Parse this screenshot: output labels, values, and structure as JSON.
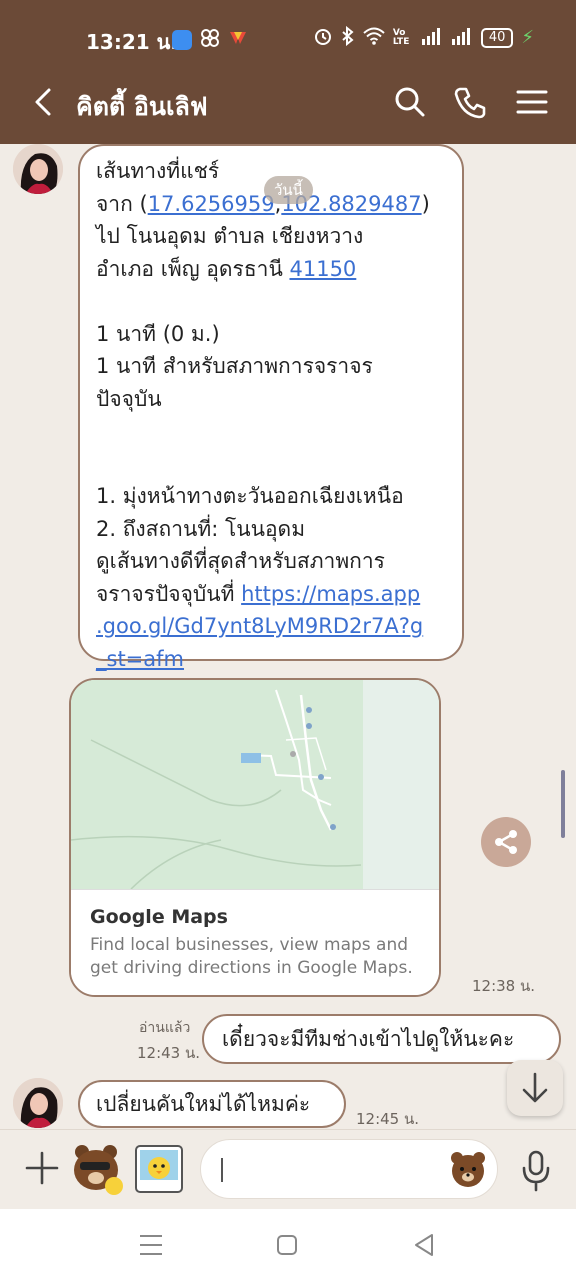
{
  "status_bar": {
    "time": "13:21 น.",
    "battery": "40",
    "network": "Vo LTE",
    "app_icons": [
      "blue-app-icon",
      "pinwheel-icon",
      "red-yellow-app-icon"
    ]
  },
  "header": {
    "title": "คิตตี้ อินเลิฟ",
    "icons": [
      "back-arrow-icon",
      "search-icon",
      "phone-icon",
      "menu-icon"
    ]
  },
  "chat": {
    "date_pill": "วันนี้",
    "message1": {
      "line1": "เส้นทางที่แชร์",
      "from_prefix": "จาก (",
      "coord1": "17.6256959",
      "comma": ",",
      "coord2": "102.8829487",
      "from_suffix": ")",
      "line3": "ไป โนนอุดม ตำบล เชียงหวาง",
      "line4_prefix": "อำเภอ เพ็ญ อุดรธานี ",
      "postcode": "41150",
      "duration": "1 นาที (0 ม.)",
      "traffic1": "1 นาที สำหรับสภาพการจราจร",
      "traffic2": "ปัจจุบัน",
      "step1": "1. มุ่งหน้าทางตะวันออกเฉียงเหนือ",
      "step2": "2. ถึงสถานที่: โนนอุดม",
      "best1": "ดูเส้นทางดีที่สุดสำหรับสภาพการ",
      "best2_prefix": "จราจรปัจจุบันที่ ",
      "url_part1": "https://maps.app",
      "url_part2": ".goo.gl/Gd7ynt8LyM9RD2r7A?g",
      "url_part3": "_st=afm"
    },
    "map_card": {
      "title": "Google Maps",
      "description": "Find local businesses, view maps and get driving directions in Google Maps.",
      "time": "12:38 น."
    },
    "message_sent": {
      "text": "เดี๋ยวจะมีทีมช่างเข้าไปดูให้นะคะ",
      "read": "อ่านแล้ว",
      "time": "12:43 น."
    },
    "message_last": {
      "text": "เปลี่ยนคันใหม่ได้ไหมค่ะ",
      "time": "12:45 น."
    }
  },
  "input_bar": {
    "placeholder": "",
    "icons": [
      "plus-icon",
      "brown-sticker-icon",
      "sally-sticker-icon",
      "bear-emoji-icon",
      "microphone-icon"
    ]
  },
  "nav_bar": {
    "icons": [
      "recent-apps-icon",
      "home-icon",
      "back-icon"
    ]
  },
  "colors": {
    "header_bg": "#6b4a37",
    "bubble_border": "#9c7c6a",
    "chat_bg": "#f1ece6",
    "link": "#3b6fd1"
  }
}
